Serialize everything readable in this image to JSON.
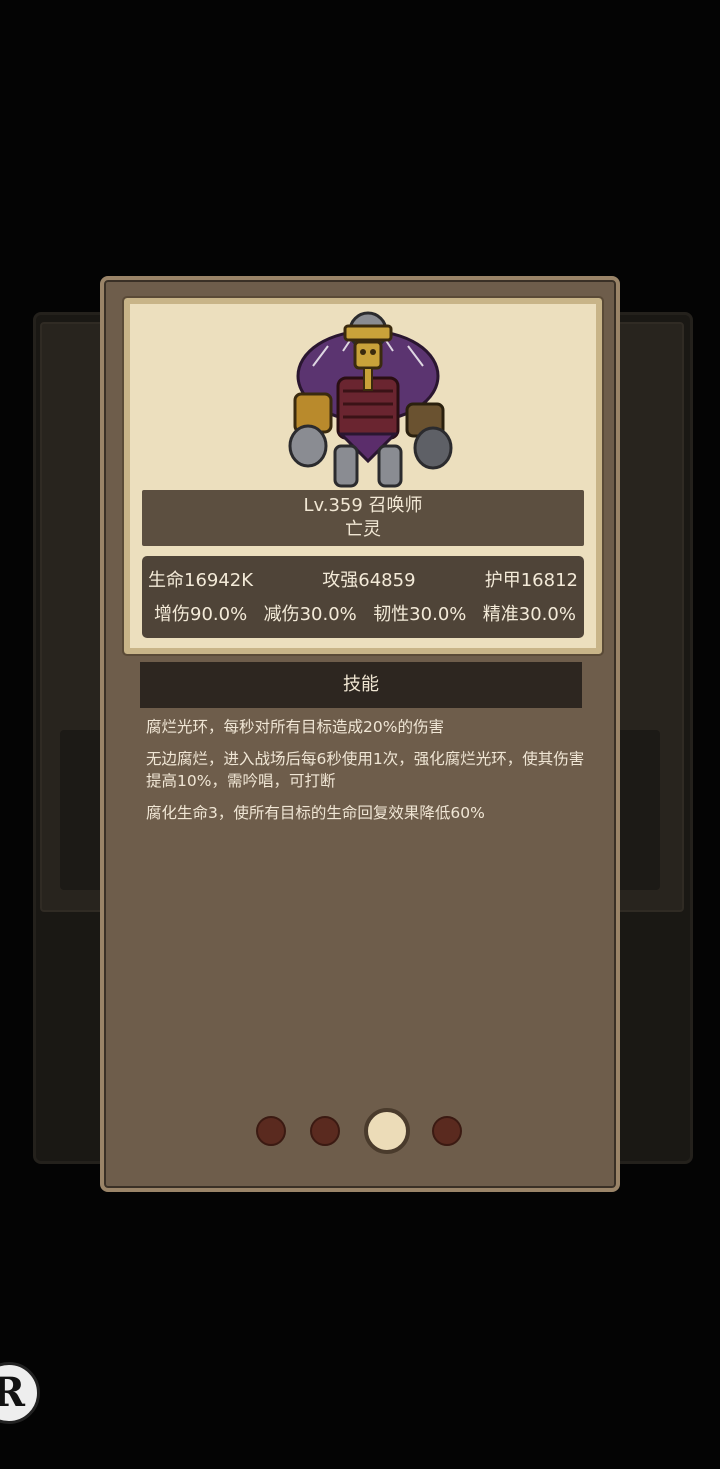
{
  "monster": {
    "level_class": "Lv.359 召唤师",
    "race": "亡灵"
  },
  "stats": {
    "row1": [
      "生命16942K",
      "攻强64859",
      "护甲16812"
    ],
    "row2": [
      "增伤90.0%",
      "减伤30.0%",
      "韧性30.0%",
      "精准30.0%"
    ]
  },
  "skills": {
    "header": "技能",
    "items": [
      "腐烂光环，每秒对所有目标造成20%的伤害",
      "无边腐烂，进入战场后每6秒使用1次，强化腐烂光环，使其伤害提高10%，需吟唱，可打断",
      "腐化生命3，使所有目标的生命回复效果降低60%"
    ]
  },
  "pagination": {
    "total": 4,
    "current": 3
  },
  "corner_badge": {
    "letter": "R"
  },
  "icons": {
    "character": "undead-summoner-portrait",
    "badge": "record-icon"
  },
  "colors": {
    "dialog": "#6e5d4b",
    "card": "#ecdfbe",
    "header": "#2d2620"
  }
}
